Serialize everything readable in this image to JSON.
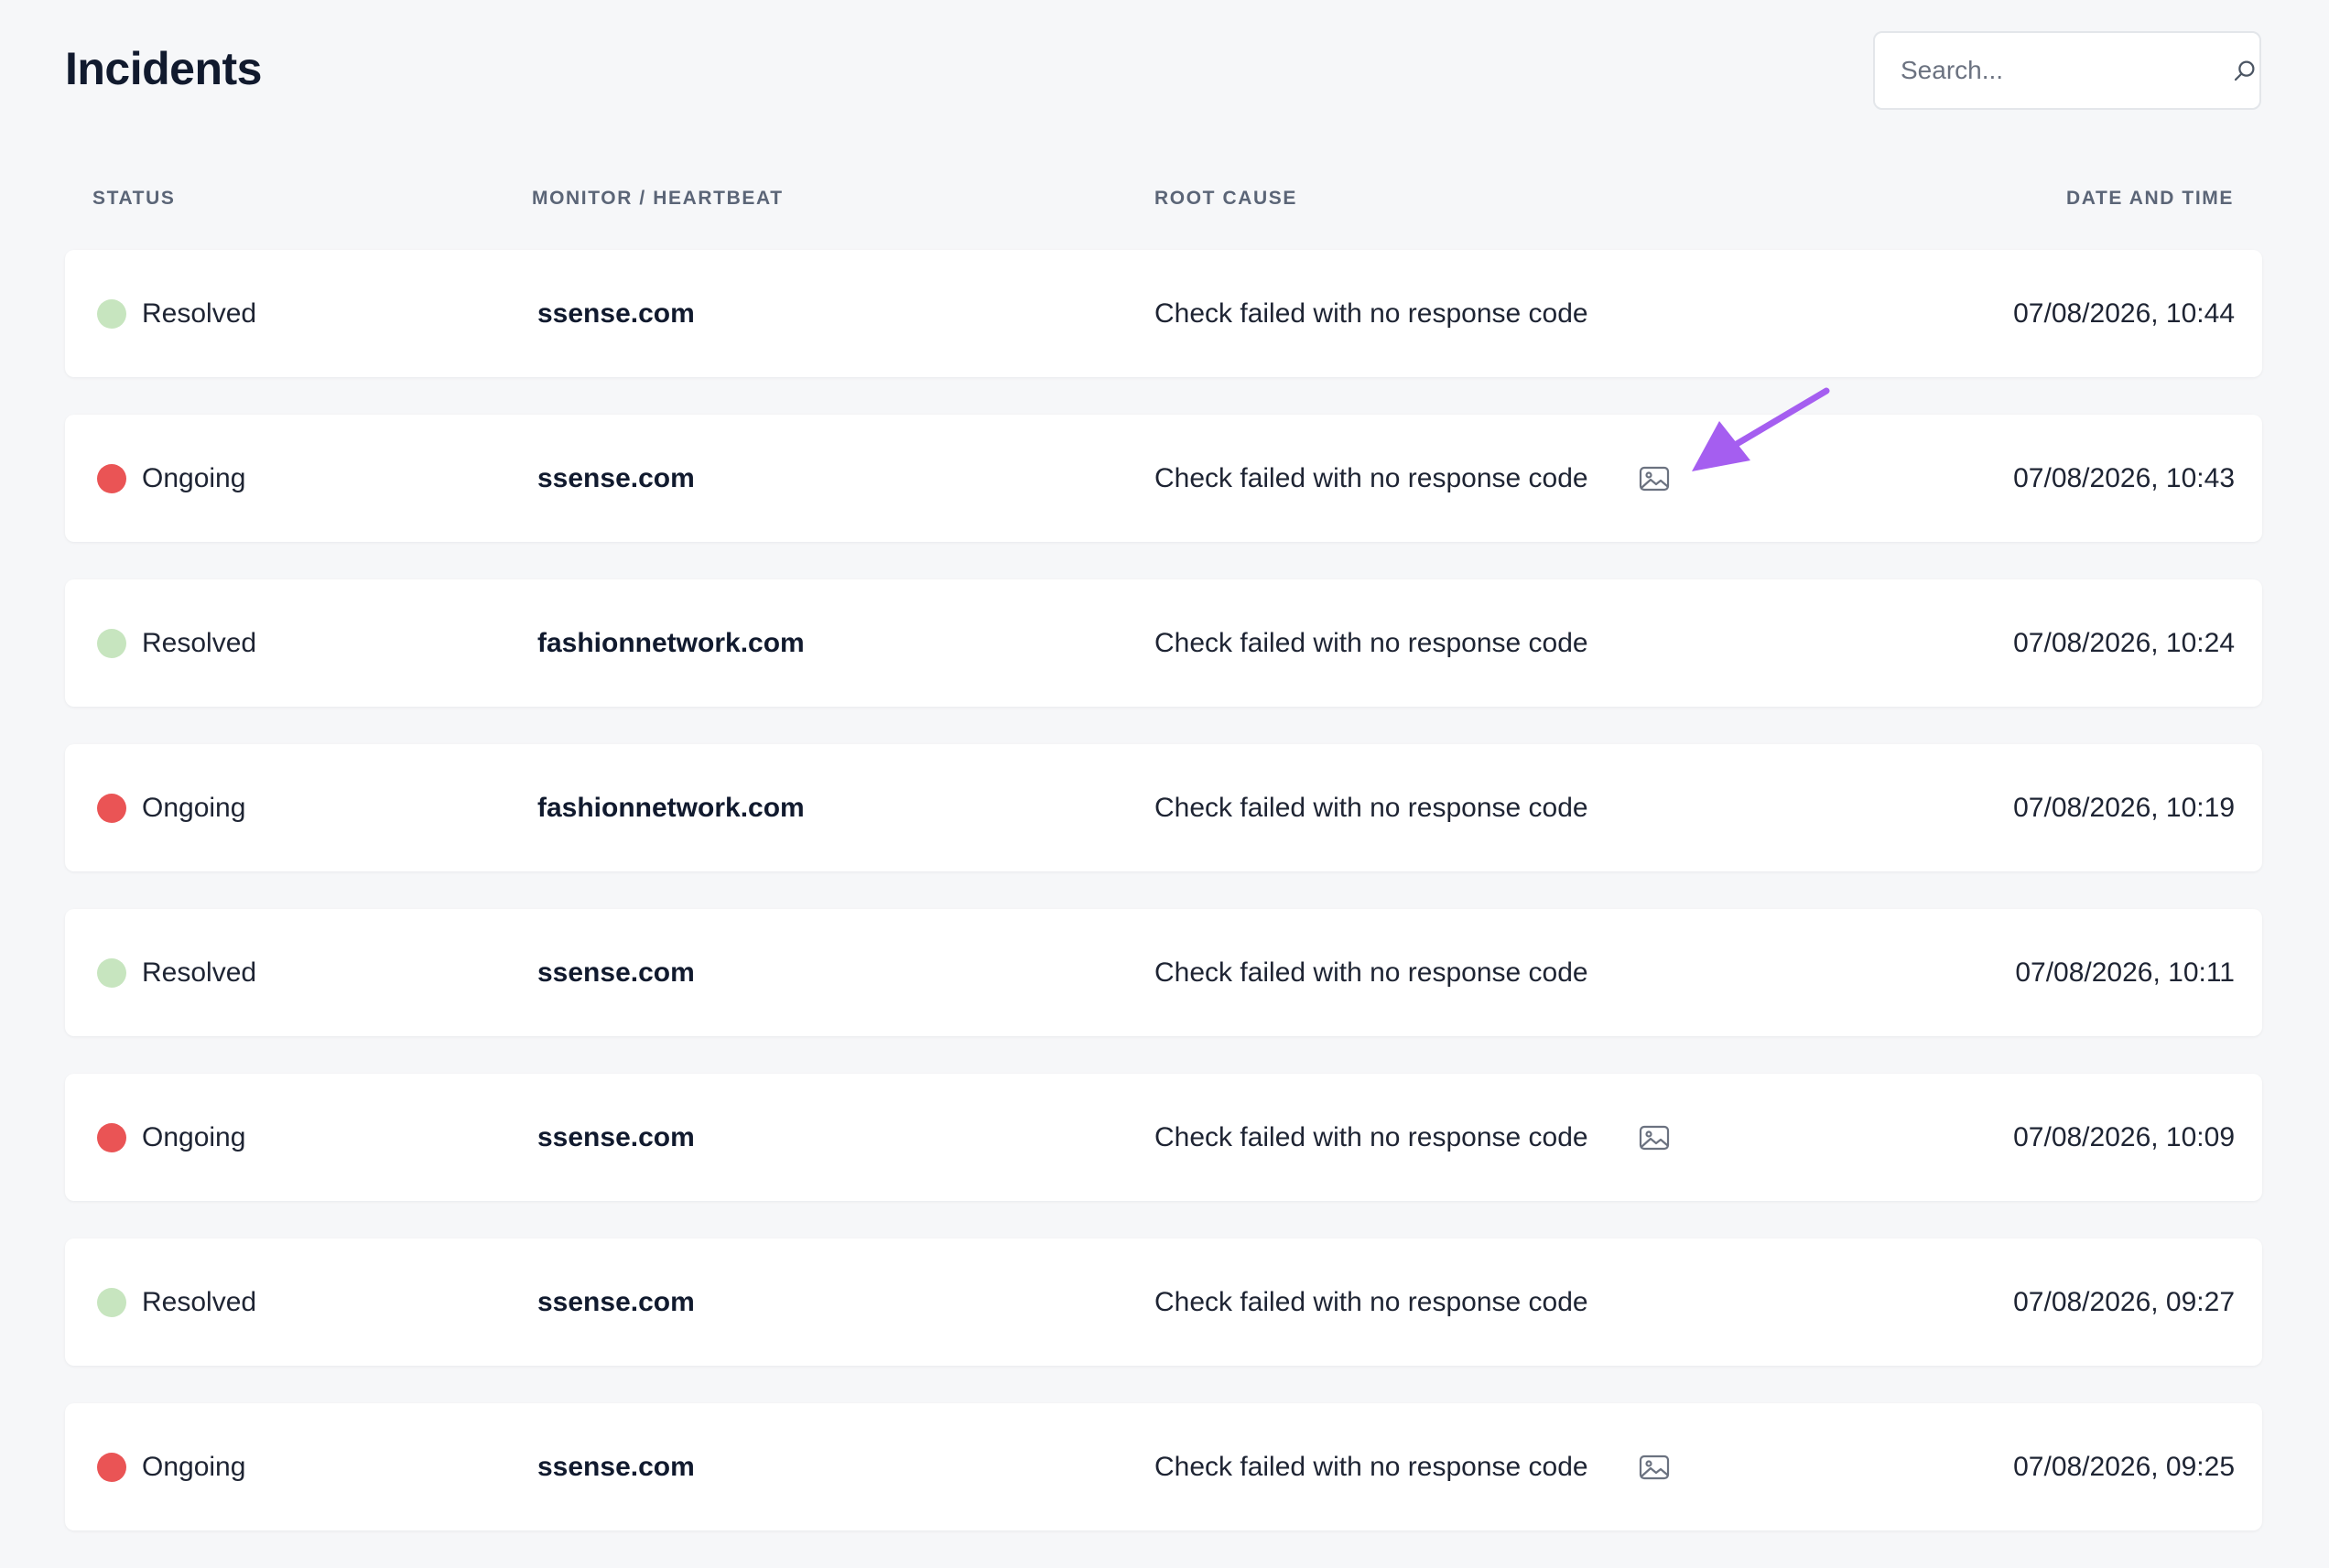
{
  "page": {
    "title": "Incidents"
  },
  "search": {
    "placeholder": "Search...",
    "value": "",
    "icon": "search-icon"
  },
  "table": {
    "headers": {
      "status": "STATUS",
      "monitor": "MONITOR / HEARTBEAT",
      "root_cause": "ROOT CAUSE",
      "date": "DATE AND TIME"
    },
    "rows": [
      {
        "status": "Resolved",
        "monitor": "ssense.com",
        "root_cause": "Check failed with no response code",
        "has_screenshot": false,
        "date": "07/08/2026, 10:44"
      },
      {
        "status": "Ongoing",
        "monitor": "ssense.com",
        "root_cause": "Check failed with no response code",
        "has_screenshot": true,
        "date": "07/08/2026, 10:43"
      },
      {
        "status": "Resolved",
        "monitor": "fashionnetwork.com",
        "root_cause": "Check failed with no response code",
        "has_screenshot": false,
        "date": "07/08/2026, 10:24"
      },
      {
        "status": "Ongoing",
        "monitor": "fashionnetwork.com",
        "root_cause": "Check failed with no response code",
        "has_screenshot": false,
        "date": "07/08/2026, 10:19"
      },
      {
        "status": "Resolved",
        "monitor": "ssense.com",
        "root_cause": "Check failed with no response code",
        "has_screenshot": false,
        "date": "07/08/2026, 10:11"
      },
      {
        "status": "Ongoing",
        "monitor": "ssense.com",
        "root_cause": "Check failed with no response code",
        "has_screenshot": true,
        "date": "07/08/2026, 10:09"
      },
      {
        "status": "Resolved",
        "monitor": "ssense.com",
        "root_cause": "Check failed with no response code",
        "has_screenshot": false,
        "date": "07/08/2026, 09:27"
      },
      {
        "status": "Ongoing",
        "monitor": "ssense.com",
        "root_cause": "Check failed with no response code",
        "has_screenshot": true,
        "date": "07/08/2026, 09:25"
      }
    ]
  },
  "colors": {
    "resolved": "#c7e5bf",
    "ongoing": "#ea5455",
    "annotation_arrow": "#a55ef0",
    "icon_gray": "#6b7280"
  },
  "annotation": {
    "type": "arrow",
    "points_to": "screenshot-icon in row 2"
  }
}
